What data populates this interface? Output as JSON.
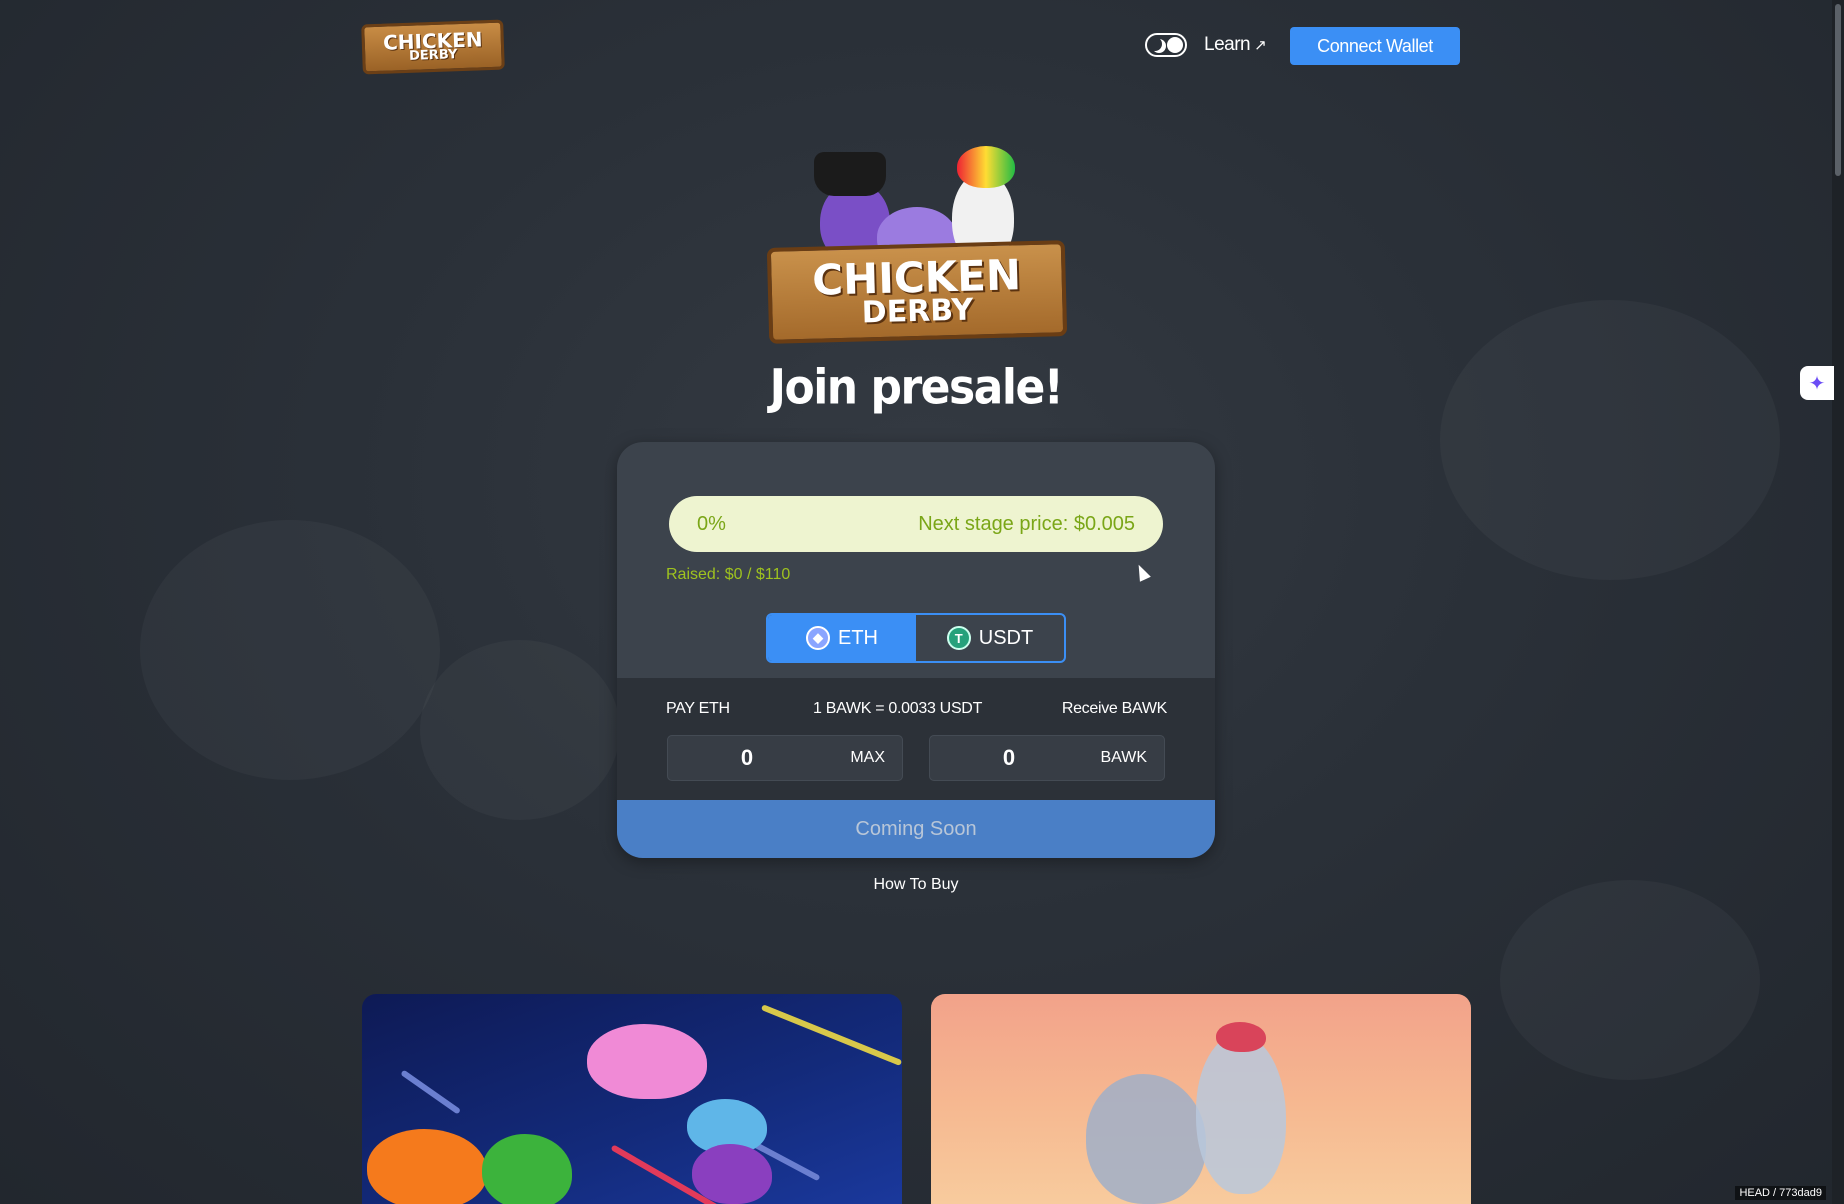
{
  "header": {
    "logo_line1": "CHICKEN",
    "logo_line2": "DERBY",
    "learn_label": "Learn",
    "learn_ext_icon": "external-link-icon",
    "connect_label": "Connect Wallet",
    "toggle_icon": "moon-icon"
  },
  "hero": {
    "logo_line1": "CHICKEN",
    "logo_line2": "DERBY",
    "title": "Join presale!"
  },
  "presale": {
    "progress_percent": "0%",
    "progress_value": 0,
    "next_stage": "Next stage price: $0.005",
    "raised": "Raised: $0 / $110",
    "tabs": [
      {
        "label": "ETH",
        "icon": "ethereum-icon",
        "active": true
      },
      {
        "label": "USDT",
        "icon": "tether-icon",
        "active": false
      }
    ],
    "pay_label": "PAY ETH",
    "rate": "1 BAWK = 0.0033 USDT",
    "receive_label": "Receive BAWK",
    "pay_value": "0",
    "pay_action": "MAX",
    "receive_value": "0",
    "receive_unit": "BAWK",
    "cta": "Coming Soon",
    "how_to_buy": "How To Buy"
  },
  "footer": {
    "version": "HEAD / 773dad9",
    "assistant_icon": "sparkle-icon"
  },
  "colors": {
    "accent": "#3b8ff5",
    "progress_bg": "#eef4d0",
    "progress_text": "#7aa617",
    "raised_text": "#9ec21f",
    "card_bg": "#3c434c",
    "cta_bg": "#4a7fc6"
  }
}
